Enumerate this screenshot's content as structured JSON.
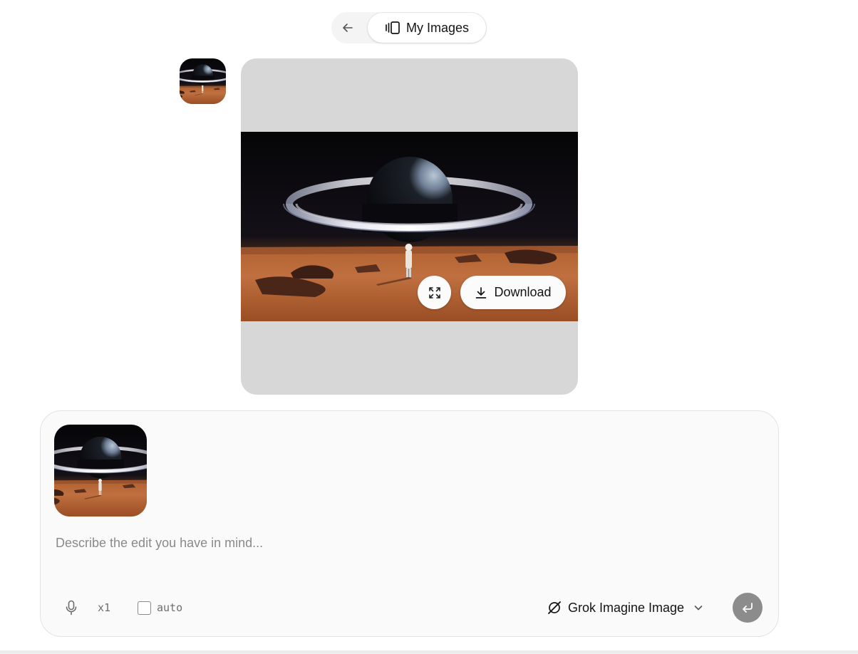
{
  "topnav": {
    "back_icon": "arrow-left-icon",
    "my_images_icon": "gallery-carousel-icon",
    "my_images_label": "My Images"
  },
  "thumbnail": {
    "icon": "ringed-planet-astronaut-image"
  },
  "image_panel": {
    "image": "ringed-planet-over-desert-with-astronaut",
    "expand_icon": "expand-arrows-icon",
    "download_icon": "download-icon",
    "download_label": "Download"
  },
  "composer": {
    "attachment": "ringed-planet-astronaut-image",
    "placeholder": "Describe the edit you have in mind...",
    "mic_icon": "microphone-icon",
    "count_label": "x1",
    "auto_label": "auto",
    "auto_checked": false,
    "model_icon": "grok-logo-icon",
    "model_label": "Grok Imagine Image",
    "chevron_icon": "chevron-down-icon",
    "send_icon": "enter-return-icon"
  },
  "colors": {
    "panel_bg": "#d7d7d7",
    "composer_bg": "#fafafa",
    "send_button": "#8c8c8c",
    "nav_pill_bg": "#f4f4f4"
  }
}
